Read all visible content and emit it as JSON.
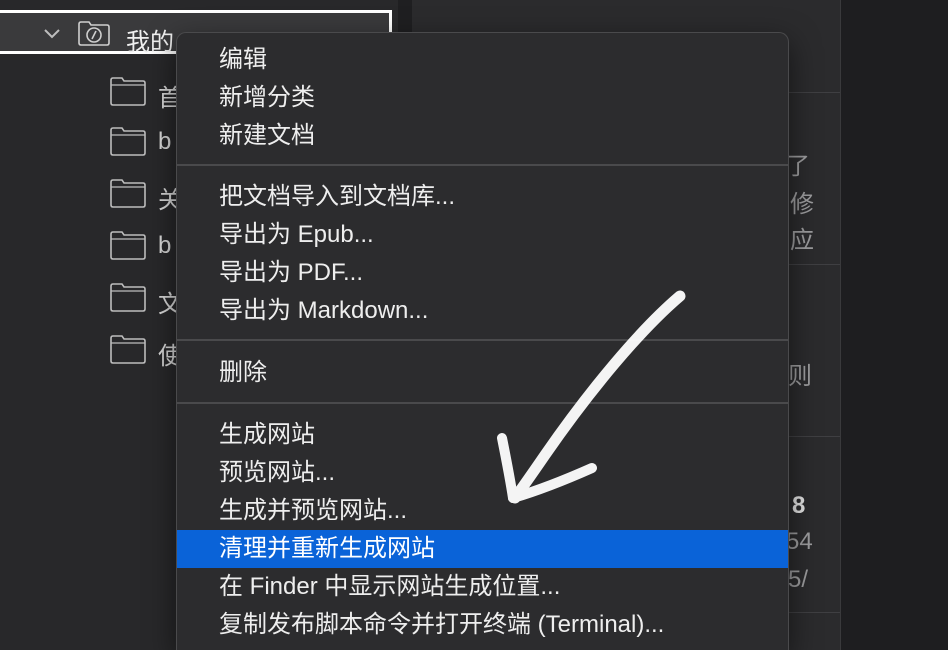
{
  "sidebar": {
    "root_label": "我的",
    "folders": [
      "首",
      "b",
      "关",
      "b",
      "文",
      "使"
    ]
  },
  "right_fragments": [
    "了",
    "修",
    "应",
    "则",
    "8",
    "54",
    "5/"
  ],
  "menu": {
    "items": [
      "编辑",
      "新增分类",
      "新建文档",
      "把文档导入到文档库...",
      "导出为 Epub...",
      "导出为 PDF...",
      "导出为 Markdown...",
      "删除",
      "生成网站",
      "预览网站...",
      "生成并预览网站...",
      "清理并重新生成网站",
      "在 Finder 中显示网站生成位置...",
      "复制发布脚本命令并打开终端 (Terminal)..."
    ],
    "highlighted_index": 11
  },
  "colors": {
    "highlight": "#0a63d8",
    "menu_bg": "#2c2c2e",
    "annotation": "#ffffff"
  },
  "icons": [
    "chevron-down-icon",
    "site-folder-icon",
    "folder-icon"
  ]
}
